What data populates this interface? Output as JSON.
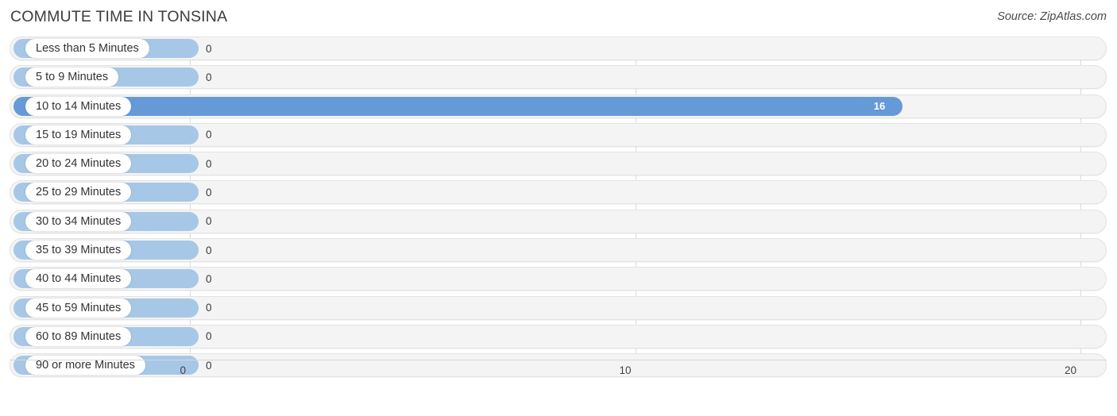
{
  "header": {
    "title": "COMMUTE TIME IN TONSINA",
    "source": "Source: ZipAtlas.com"
  },
  "colors": {
    "bar": "#a7c7e7",
    "bar_highlight": "#6699d8",
    "track": "#f4f4f4",
    "gridline": "#dcdcdc",
    "text": "#3a3a3a"
  },
  "chart_data": {
    "type": "bar",
    "orientation": "horizontal",
    "title": "COMMUTE TIME IN TONSINA",
    "xlabel": "",
    "ylabel": "",
    "xlim": [
      0,
      20
    ],
    "xticks": [
      0,
      10,
      20
    ],
    "xtick_labels": [
      "0",
      "10",
      "20"
    ],
    "grid": true,
    "legend": null,
    "categories": [
      "Less than 5 Minutes",
      "5 to 9 Minutes",
      "10 to 14 Minutes",
      "15 to 19 Minutes",
      "20 to 24 Minutes",
      "25 to 29 Minutes",
      "30 to 34 Minutes",
      "35 to 39 Minutes",
      "40 to 44 Minutes",
      "45 to 59 Minutes",
      "60 to 89 Minutes",
      "90 or more Minutes"
    ],
    "values": [
      0,
      0,
      16,
      0,
      0,
      0,
      0,
      0,
      0,
      0,
      0,
      0
    ],
    "value_labels": [
      "0",
      "0",
      "16",
      "0",
      "0",
      "0",
      "0",
      "0",
      "0",
      "0",
      "0",
      "0"
    ],
    "highlight_index": 2
  }
}
